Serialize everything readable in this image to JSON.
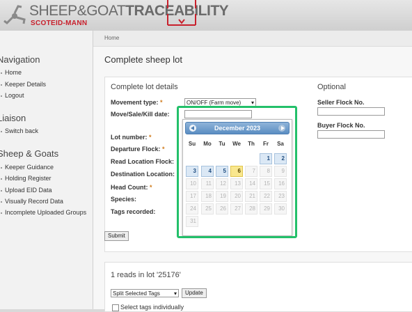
{
  "header": {
    "brand_prefix": "SHEEP&GOAT",
    "brand_suffix": "TRACEABILITY",
    "brand_sub": "SCOTEID-MANN"
  },
  "sidebar": {
    "navigation_heading": "Navigation",
    "navigation": [
      "Home",
      "Keeper Details",
      "Logout"
    ],
    "liaison_heading": "Liaison",
    "liaison": [
      "Switch back"
    ],
    "sheep_goats_heading": "Sheep & Goats",
    "sheep_goats": [
      "Keeper Guidance",
      "Holding Register",
      "Upload EID Data",
      "Visually Record Data",
      "Incomplete Uploaded Groups"
    ]
  },
  "breadcrumb": {
    "home": "Home"
  },
  "page_title": "Complete sheep lot",
  "lot_details": {
    "title": "Complete lot details",
    "movement_type_label": "Movement type:",
    "movement_type_value": "ON/OFF (Farm move)",
    "move_date_label": "Move/Sale/Kill date:",
    "lot_number_label": "Lot number:",
    "departure_flock_label": "Departure Flock:",
    "read_location_label": "Read Location Flock:",
    "destination_label": "Destination Location:",
    "head_count_label": "Head Count:",
    "species_label": "Species:",
    "tags_recorded_label": "Tags recorded:",
    "required_mark": "*"
  },
  "optional": {
    "title": "Optional",
    "seller_flock_label": "Seller Flock No.",
    "buyer_flock_label": "Buyer Flock No."
  },
  "submit_label": "Submit",
  "reads": {
    "title": "1 reads in lot '25176'",
    "action_select_value": "Split Selected Tags",
    "update_label": "Update",
    "select_individually_label": "Select tags individually"
  },
  "datepicker": {
    "month_label": "December 2023",
    "prev_label": "Prev",
    "next_label": "Next",
    "weekdays": [
      "Su",
      "Mo",
      "Tu",
      "We",
      "Th",
      "Fr",
      "Sa"
    ],
    "days": [
      [
        null,
        null,
        null,
        null,
        null,
        "1",
        "2"
      ],
      [
        "3",
        "4",
        "5",
        "6",
        "7",
        "8",
        "9"
      ],
      [
        "10",
        "11",
        "12",
        "13",
        "14",
        "15",
        "16"
      ],
      [
        "17",
        "18",
        "19",
        "20",
        "21",
        "22",
        "23"
      ],
      [
        "24",
        "25",
        "26",
        "27",
        "28",
        "29",
        "30"
      ],
      [
        "31",
        null,
        null,
        null,
        null,
        null,
        null
      ]
    ],
    "enabled_days": [
      "1",
      "2",
      "3",
      "4",
      "5",
      "6"
    ],
    "today": "6",
    "colors": {
      "header": "#5a8dc2",
      "enabled": "#dbe8f5",
      "today": "#f9e78e",
      "highlight": "#23c06a"
    }
  }
}
